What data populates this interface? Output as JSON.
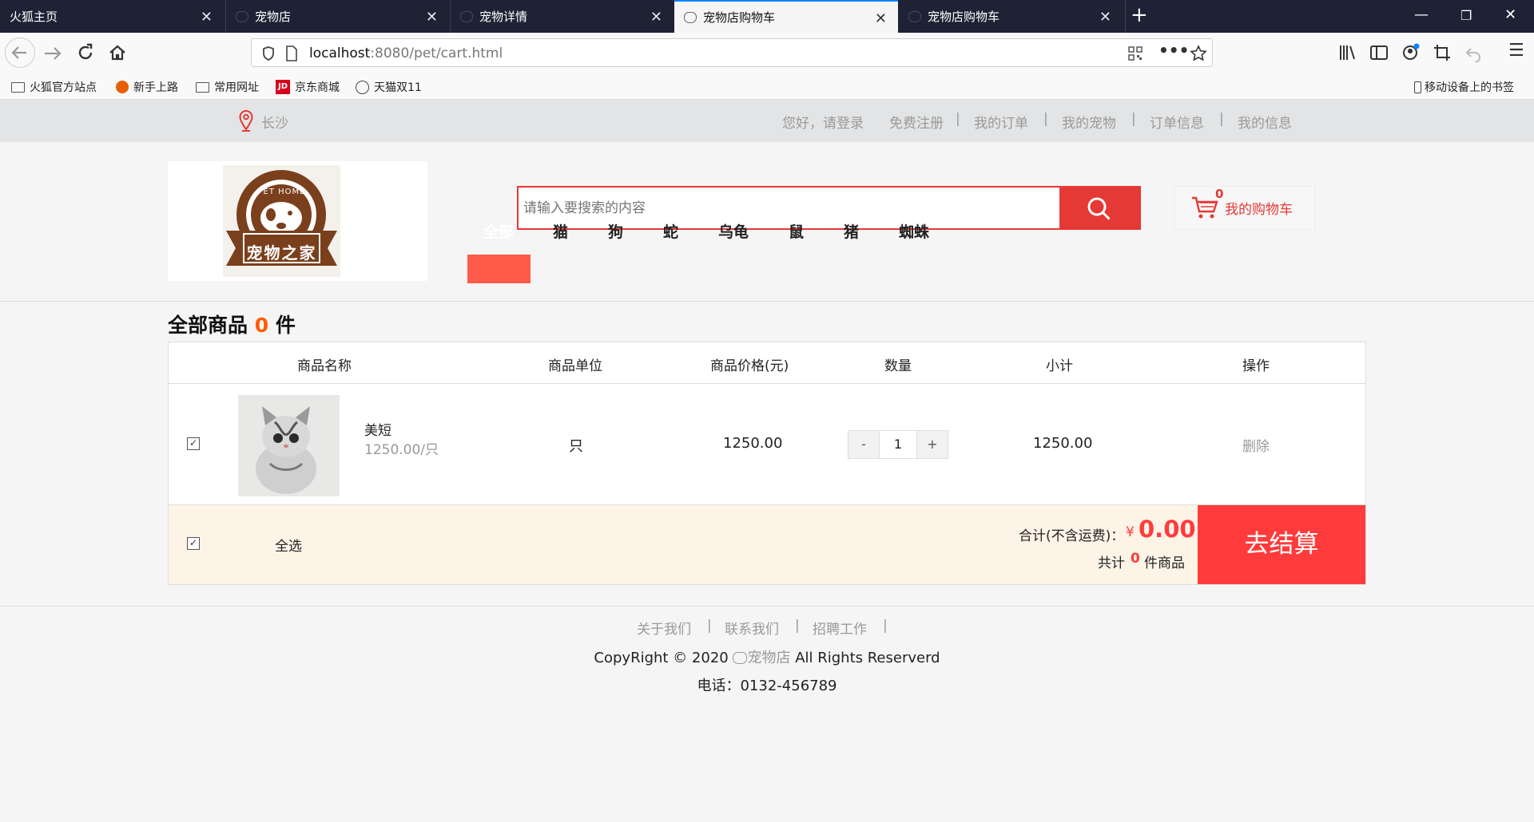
{
  "browser": {
    "tabs": [
      {
        "label": "火狐主页"
      },
      {
        "label": "宠物店"
      },
      {
        "label": "宠物详情"
      },
      {
        "label": "宠物店购物车"
      },
      {
        "label": "宠物店购物车"
      }
    ],
    "url_host": "localhost",
    "url_rest": ":8080/pet/cart.html",
    "bookmarks": [
      "火狐官方站点",
      "新手上路",
      "常用网址",
      "京东商城",
      "天猫双11"
    ],
    "mobile_bookmarks": "移动设备上的书签"
  },
  "topbar": {
    "city": "长沙",
    "links": [
      "您好，请登录",
      "免费注册",
      "我的订单",
      "我的宠物",
      "订单信息",
      "我的信息"
    ],
    "separator": "|"
  },
  "header": {
    "logo_text": "宠物之家",
    "logo_arc": "PET HOME",
    "search_placeholder": "请输入要搜索的内容",
    "cart_label": "我的购物车",
    "cart_count": "0",
    "categories": [
      "全部",
      "猫",
      "狗",
      "蛇",
      "乌龟",
      "鼠",
      "猪",
      "蜘蛛"
    ],
    "accent": "#e53935",
    "active_category_color": "#ff5a4a"
  },
  "cart": {
    "title_prefix": "全部商品",
    "count": "0",
    "title_suffix": "件",
    "columns": [
      "商品名称",
      "商品单位",
      "商品价格(元)",
      "数量",
      "小计",
      "操作"
    ],
    "items": [
      {
        "name": "美短",
        "unit_price_label": "1250.00/只",
        "unit": "只",
        "price": "1250.00",
        "quantity": "1",
        "subtotal": "1250.00",
        "action": "删除",
        "checked": true,
        "minus": "-",
        "plus": "+"
      }
    ],
    "select_all": "全选",
    "select_all_checked": true,
    "total_label": "合计(不含运费)：",
    "currency": "¥",
    "total": "0.00",
    "count_prefix": "共计",
    "count_value": "0",
    "count_suffix": "件商品",
    "checkout": "去结算",
    "checkout_color": "#ff3b3b"
  },
  "footer": {
    "links": [
      "关于我们",
      "联系我们",
      "招聘工作"
    ],
    "sep": "|",
    "copyright_pre": "CopyRight © 2020",
    "copyright_brand": "宠物店",
    "copyright_post": "All Rights Reserverd",
    "phone": "电话：0132-456789"
  }
}
